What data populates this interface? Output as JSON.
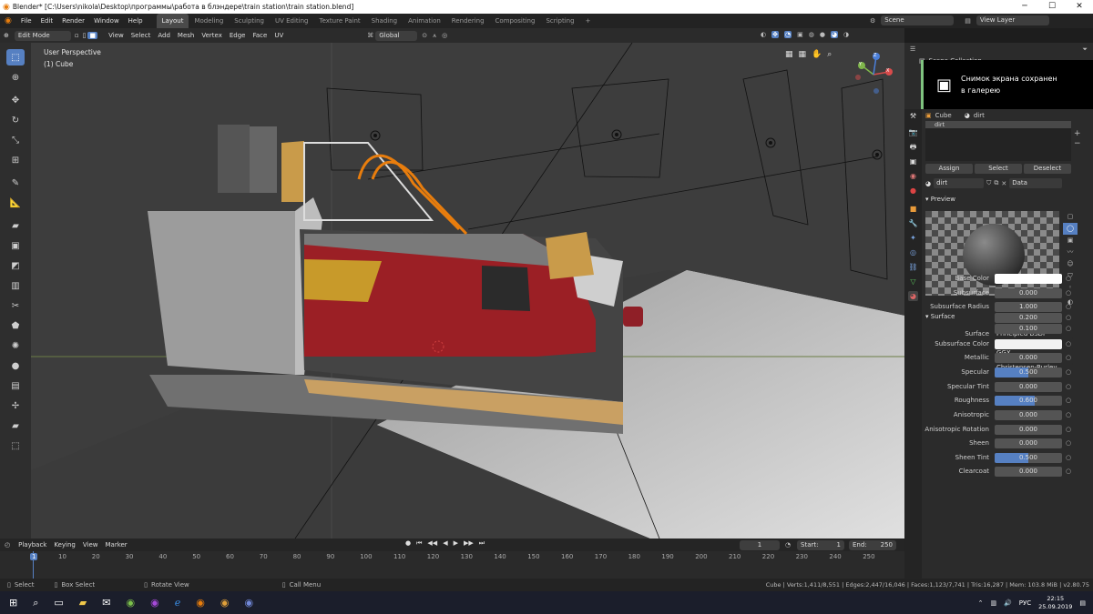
{
  "titlebar": {
    "title": "Blender* [C:\\Users\\nikola\\Desktop\\программы\\работа в блэндере\\train station\\train station.blend]",
    "minimize": "─",
    "maximize": "☐",
    "close": "✕"
  },
  "menu": [
    "File",
    "Edit",
    "Render",
    "Window",
    "Help"
  ],
  "workspaces": [
    "Layout",
    "Modeling",
    "Sculpting",
    "UV Editing",
    "Texture Paint",
    "Shading",
    "Animation",
    "Rendering",
    "Compositing",
    "Scripting"
  ],
  "workspace_add": "+",
  "scene": "Scene",
  "view_layer": "View Layer",
  "viewport_header": {
    "mode": "Edit Mode",
    "menus": [
      "View",
      "Select",
      "Add",
      "Mesh",
      "Vertex",
      "Edge",
      "Face",
      "UV"
    ],
    "transform": "Global"
  },
  "viewport": {
    "perspective": "User Perspective",
    "object": "(1) Cube",
    "gizmo": {
      "x": "X",
      "y": "Y",
      "z": "Z"
    }
  },
  "timeline": {
    "menus": [
      "Playback",
      "Keying",
      "View",
      "Marker"
    ],
    "current_frame": "1",
    "start_label": "Start:",
    "start": "1",
    "end_label": "End:",
    "end": "250",
    "ticks": [
      "1",
      "10",
      "20",
      "30",
      "40",
      "50",
      "60",
      "70",
      "80",
      "90",
      "100",
      "110",
      "120",
      "130",
      "140",
      "150",
      "160",
      "170",
      "180",
      "190",
      "200",
      "210",
      "220",
      "230",
      "240",
      "250"
    ]
  },
  "statusbar": {
    "select": "Select",
    "box_select": "Box Select",
    "rotate": "Rotate View",
    "call_menu": "Call Menu",
    "stats": "Cube | Verts:1,411/8,551 | Edges:2,447/16,046 | Faces:1,123/7,741 | Tris:16,287 | Mem: 103.8 MiB | v2.80.75"
  },
  "outliner": {
    "title": "Scene Collection"
  },
  "toast": {
    "line1": "Снимок экрана сохранен",
    "line2": "в галерею"
  },
  "material": {
    "object": "Cube",
    "material": "dirt",
    "slot": "dirt",
    "assign": "Assign",
    "select": "Select",
    "deselect": "Deselect",
    "data": "Data",
    "preview": "Preview",
    "surface_section": "Surface",
    "surface_label": "Surface",
    "surface_value": "Principled BSDF",
    "distribution": "GGX",
    "sss_method": "Christensen-Burley",
    "props": [
      {
        "label": "Base Color",
        "value": "",
        "kind": "color",
        "color": "#ffffff"
      },
      {
        "label": "Subsurface",
        "value": "0.000"
      },
      {
        "label": "Subsurface Radius",
        "value": "1.000"
      },
      {
        "label": "",
        "value": "0.200"
      },
      {
        "label": "",
        "value": "0.100"
      },
      {
        "label": "Subsurface Color",
        "value": "",
        "kind": "color",
        "color": "#f2f2f2"
      },
      {
        "label": "Metallic",
        "value": "0.000"
      },
      {
        "label": "Specular",
        "value": "0.500",
        "fill": 0.5
      },
      {
        "label": "Specular Tint",
        "value": "0.000"
      },
      {
        "label": "Roughness",
        "value": "0.600",
        "fill": 0.6
      },
      {
        "label": "Anisotropic",
        "value": "0.000"
      },
      {
        "label": "Anisotropic Rotation",
        "value": "0.000"
      },
      {
        "label": "Sheen",
        "value": "0.000"
      },
      {
        "label": "Sheen Tint",
        "value": "0.500",
        "fill": 0.5
      },
      {
        "label": "Clearcoat",
        "value": "0.000"
      }
    ]
  },
  "taskbar": {
    "lang": "РУС",
    "time": "22:15",
    "date": "25.09.2019"
  }
}
